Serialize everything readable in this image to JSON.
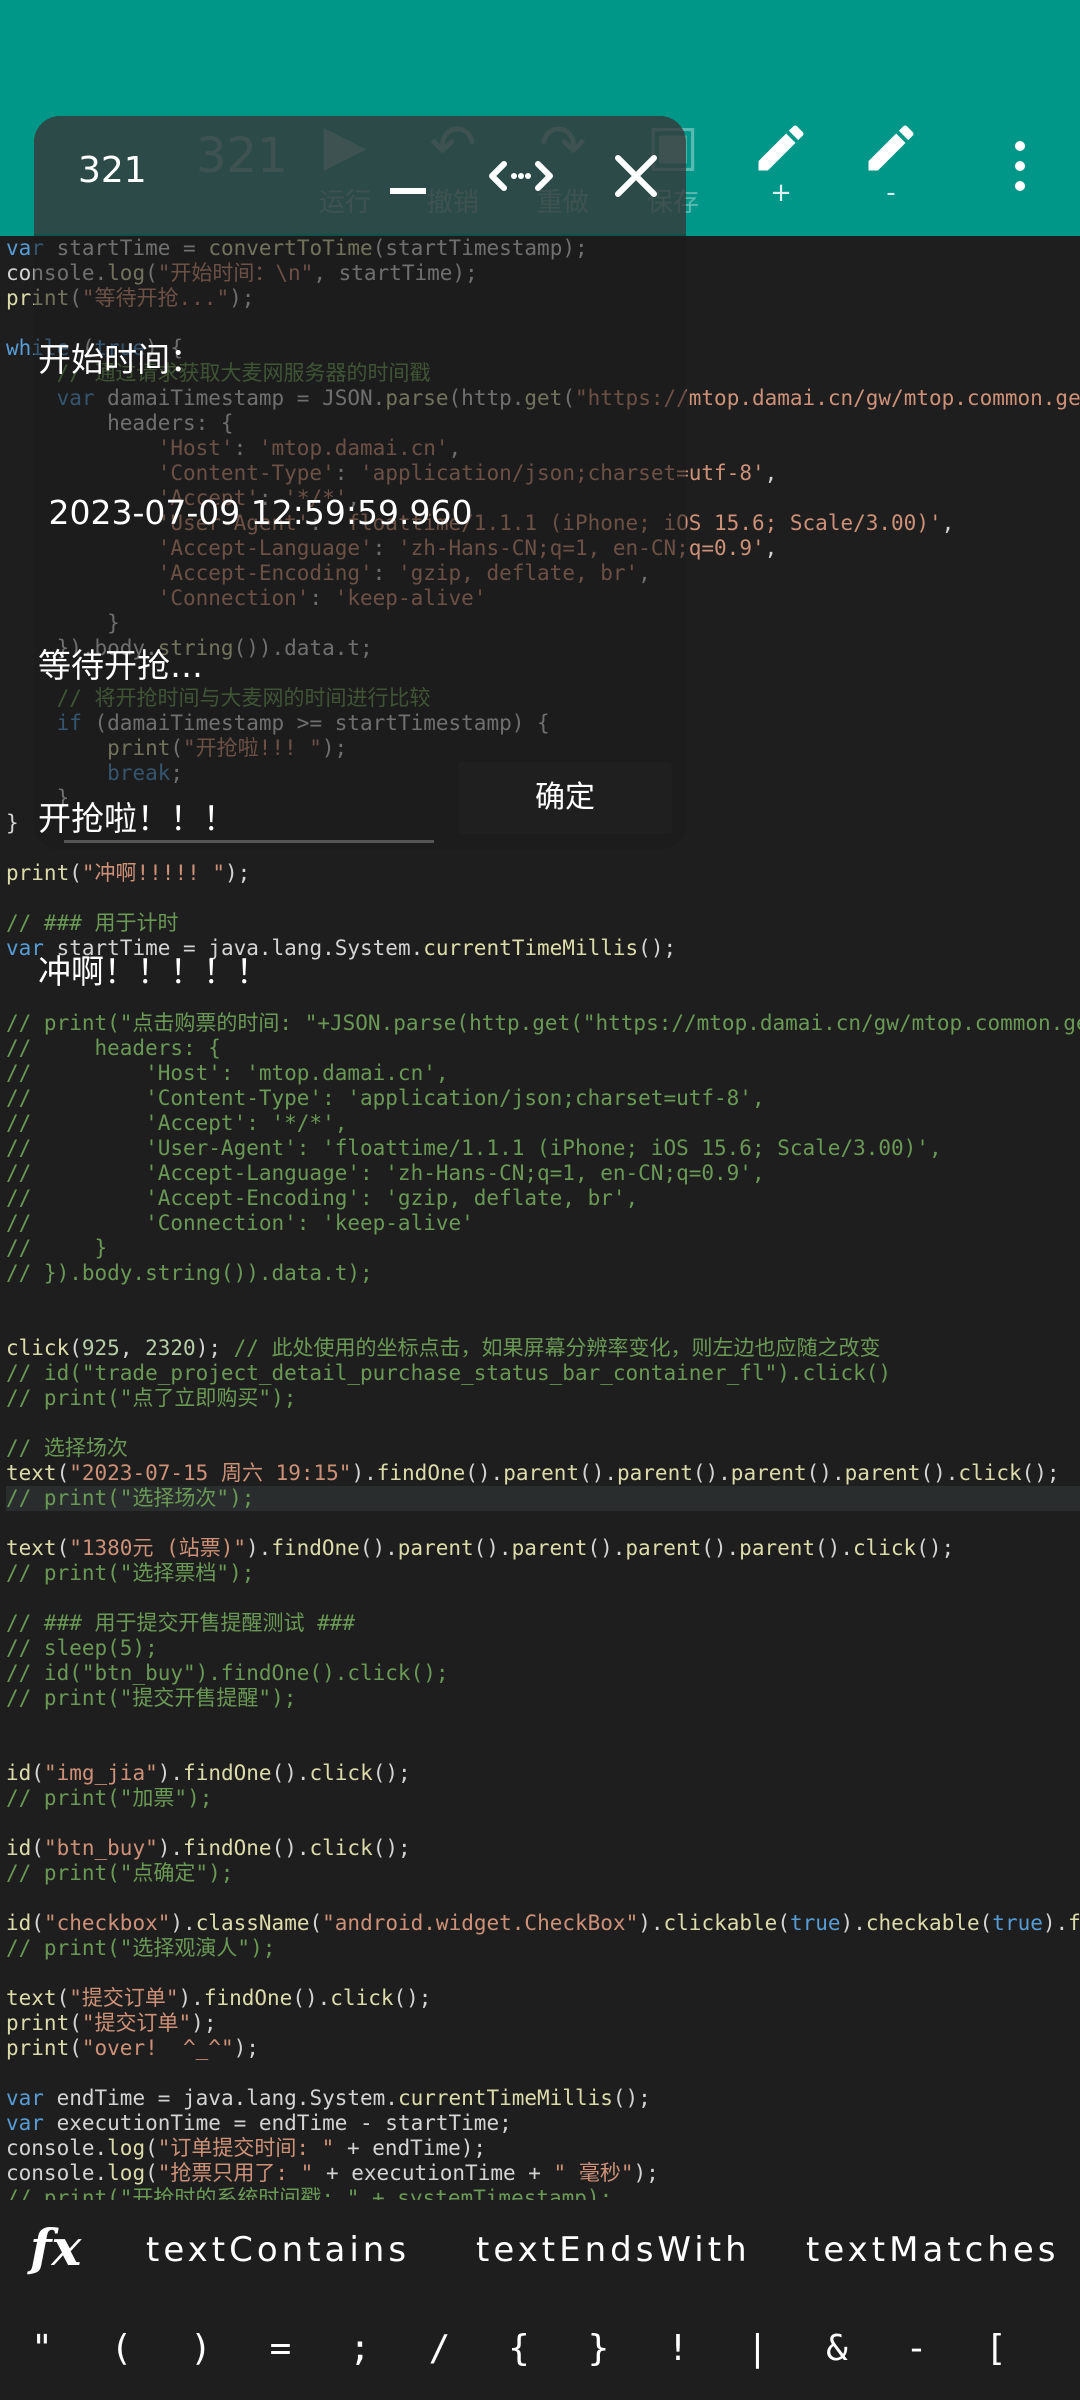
{
  "toolbar": {
    "title": "321",
    "run_label": "运行",
    "undo_label": "撤销",
    "redo_label": "重做",
    "save_label": "保存",
    "zoom_in_label": "+",
    "zoom_out_label": "-",
    "accent_color": "#009688"
  },
  "floating_console": {
    "title": "321",
    "log_lines": [
      "开始时间：",
      " 2023-07-09 12:59:59.960",
      "等待开抢…",
      "开抢啦！！！",
      "冲啊！！！！！"
    ],
    "ok_label": "确定",
    "icons": [
      "minimize-icon",
      "resize-icon",
      "close-icon"
    ]
  },
  "code_lines": [
    "var startTime = convertToTime(startTimestamp);",
    "console.log(\"开始时间：\\n\", startTime);",
    "print(\"等待开抢...\");",
    "",
    "while (true) {",
    "    // 通过请求获取大麦网服务器的时间戳",
    "    var damaiTimestamp = JSON.parse(http.get(\"https://mtop.damai.cn/gw/mtop.common.getTimestamp/\", {",
    "        headers: {",
    "            'Host': 'mtop.damai.cn',",
    "            'Content-Type': 'application/json;charset=utf-8',",
    "            'Accept': '*/*',",
    "            'User-Agent': 'floattime/1.1.1 (iPhone; iOS 15.6; Scale/3.00)',",
    "            'Accept-Language': 'zh-Hans-CN;q=1, en-CN;q=0.9',",
    "            'Accept-Encoding': 'gzip, deflate, br',",
    "            'Connection': 'keep-alive'",
    "        }",
    "    }).body.string()).data.t;",
    "",
    "    // 将开抢时间与大麦网的时间进行比较",
    "    if (damaiTimestamp >= startTimestamp) {",
    "        print(\"开抢啦!!! \");",
    "        break;",
    "    }",
    "}",
    "",
    "print(\"冲啊!!!!! \");",
    "",
    "// ### 用于计时",
    "var startTime = java.lang.System.currentTimeMillis();",
    "",
    "",
    "// print(\"点击购票的时间: \"+JSON.parse(http.get(\"https://mtop.damai.cn/gw/mtop.common.getTimestamp/\", {",
    "//     headers: {",
    "//         'Host': 'mtop.damai.cn',",
    "//         'Content-Type': 'application/json;charset=utf-8',",
    "//         'Accept': '*/*',",
    "//         'User-Agent': 'floattime/1.1.1 (iPhone; iOS 15.6; Scale/3.00)',",
    "//         'Accept-Language': 'zh-Hans-CN;q=1, en-CN;q=0.9',",
    "//         'Accept-Encoding': 'gzip, deflate, br',",
    "//         'Connection': 'keep-alive'",
    "//     }",
    "// }).body.string()).data.t);",
    "",
    "",
    "click(925, 2320); // 此处使用的坐标点击，如果屏幕分辨率变化，则左边也应随之改变",
    "// id(\"trade_project_detail_purchase_status_bar_container_fl\").click()",
    "// print(\"点了立即购买\");",
    "",
    "// 选择场次",
    "text(\"2023-07-15 周六 19:15\").findOne().parent().parent().parent().parent().click();",
    "// print(\"选择场次\");",
    "",
    "text(\"1380元 (站票)\").findOne().parent().parent().parent().parent().click();",
    "// print(\"选择票档\");",
    "",
    "// ### 用于提交开售提醒测试 ###",
    "// sleep(5);",
    "// id(\"btn_buy\").findOne().click();",
    "// print(\"提交开售提醒\");",
    "",
    "",
    "id(\"img_jia\").findOne().click();",
    "// print(\"加票\");",
    "",
    "id(\"btn_buy\").findOne().click();",
    "// print(\"点确定\");",
    "",
    "id(\"checkbox\").className(\"android.widget.CheckBox\").clickable(true).checkable(true).findOne().click();",
    "// print(\"选择观演人\");",
    "",
    "text(\"提交订单\").findOne().click();",
    "print(\"提交订单\");",
    "print(\"over!  ^_^\");",
    "",
    "var endTime = java.lang.System.currentTimeMillis();",
    "var executionTime = endTime - startTime;",
    "console.log(\"订单提交时间: \" + endTime);",
    "console.log(\"抢票只用了: \" + executionTime + \" 毫秒\");",
    "// print(\"开抢时的系统时间戳: \" + systemTimestamp);"
  ],
  "highlighted_line": 50,
  "snippet_bar": {
    "fx_label": "fx",
    "items": [
      "textContains",
      "textEndsWith",
      "textMatches"
    ]
  },
  "symbol_bar": [
    "\"",
    "(",
    ")",
    "=",
    ";",
    "/",
    "{",
    "}",
    "!",
    "|",
    "&",
    "-",
    "["
  ]
}
